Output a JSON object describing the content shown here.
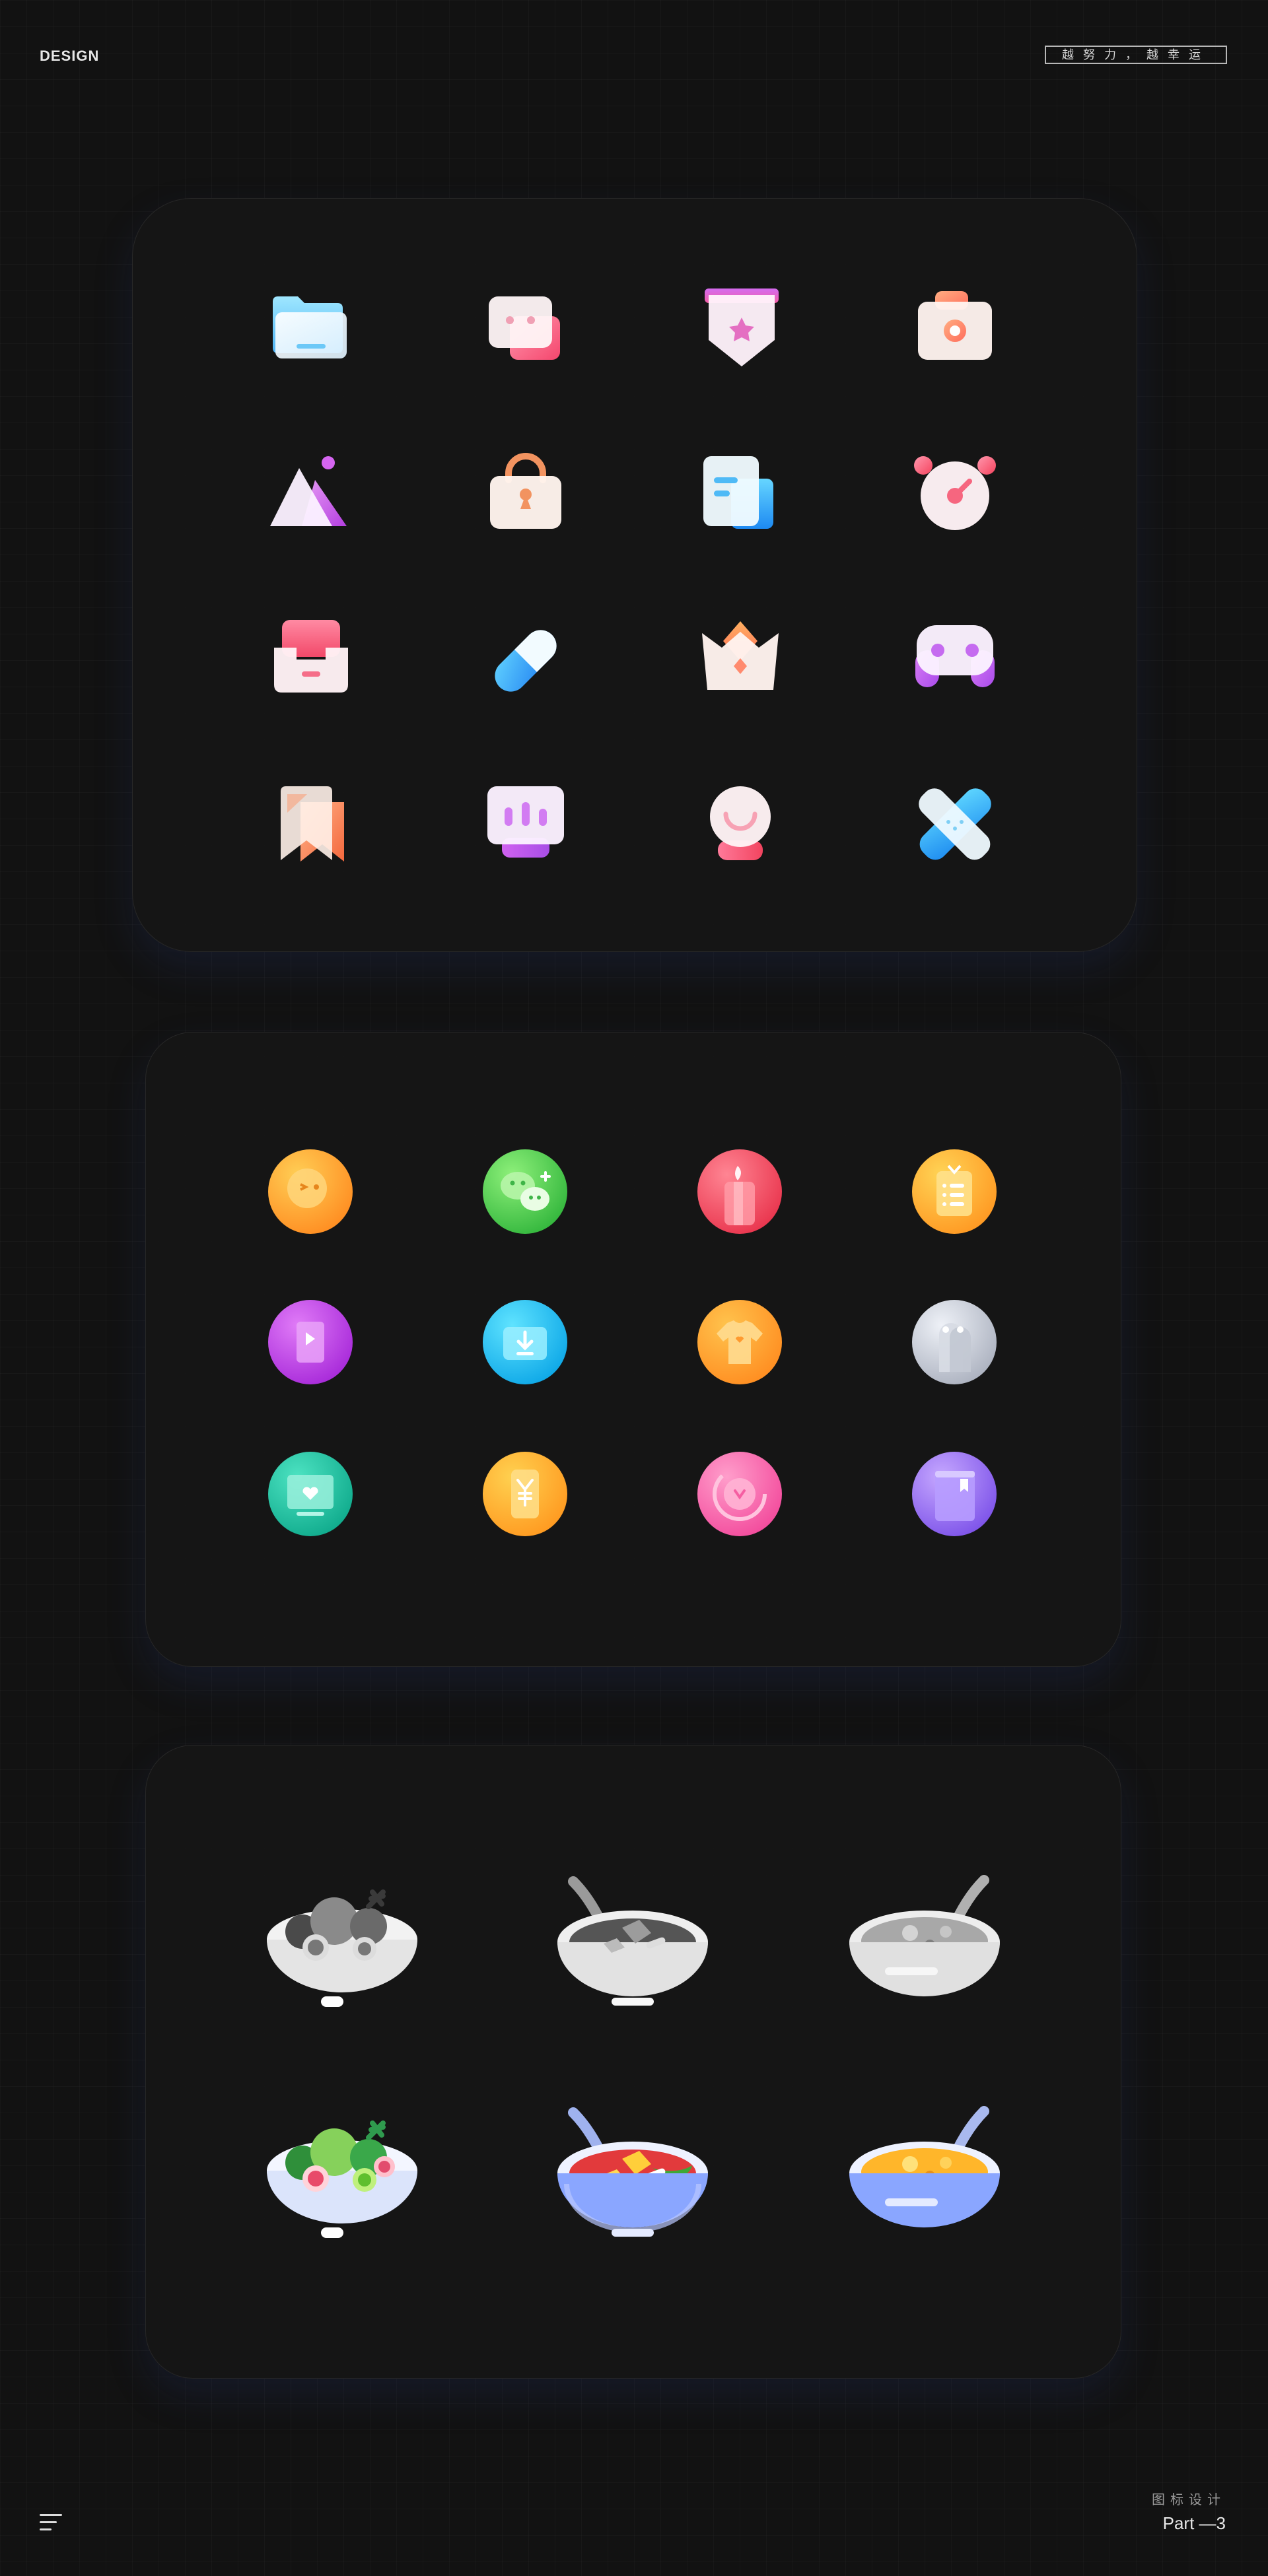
{
  "header": {
    "brand": "DESIGN",
    "slogan": "越努力，越幸运"
  },
  "sections": [
    {
      "name": "glass-icons",
      "icons": [
        "folder-icon",
        "chat-icon",
        "star-badge-icon",
        "camera-icon",
        "mountain-icon",
        "bag-icon",
        "document-icon",
        "alarm-clock-icon",
        "inbox-icon",
        "pill-icon",
        "crown-icon",
        "gamepad-icon",
        "bookmark-icon",
        "monitor-icon",
        "lamp-icon",
        "bandage-icon"
      ]
    },
    {
      "name": "circle-icons",
      "icons": [
        "emoji-face-icon",
        "wechat-icon",
        "candle-icon",
        "clipboard-icon",
        "video-icon",
        "download-icon",
        "tshirt-icon",
        "penguin-icon",
        "heart-screen-icon",
        "coupon-yuan-icon",
        "heart-disc-icon",
        "book-icon"
      ]
    },
    {
      "name": "bowl-icons",
      "icons": [
        "salad-bowl-gray-icon",
        "soup-bowl-gray-icon",
        "porridge-bowl-gray-icon",
        "salad-bowl-icon",
        "soup-bowl-icon",
        "porridge-bowl-icon"
      ]
    }
  ],
  "footer": {
    "subtitle": "图标设计",
    "part": "Part —3"
  },
  "colors": {
    "background": "#121212",
    "panel": "#161616"
  }
}
